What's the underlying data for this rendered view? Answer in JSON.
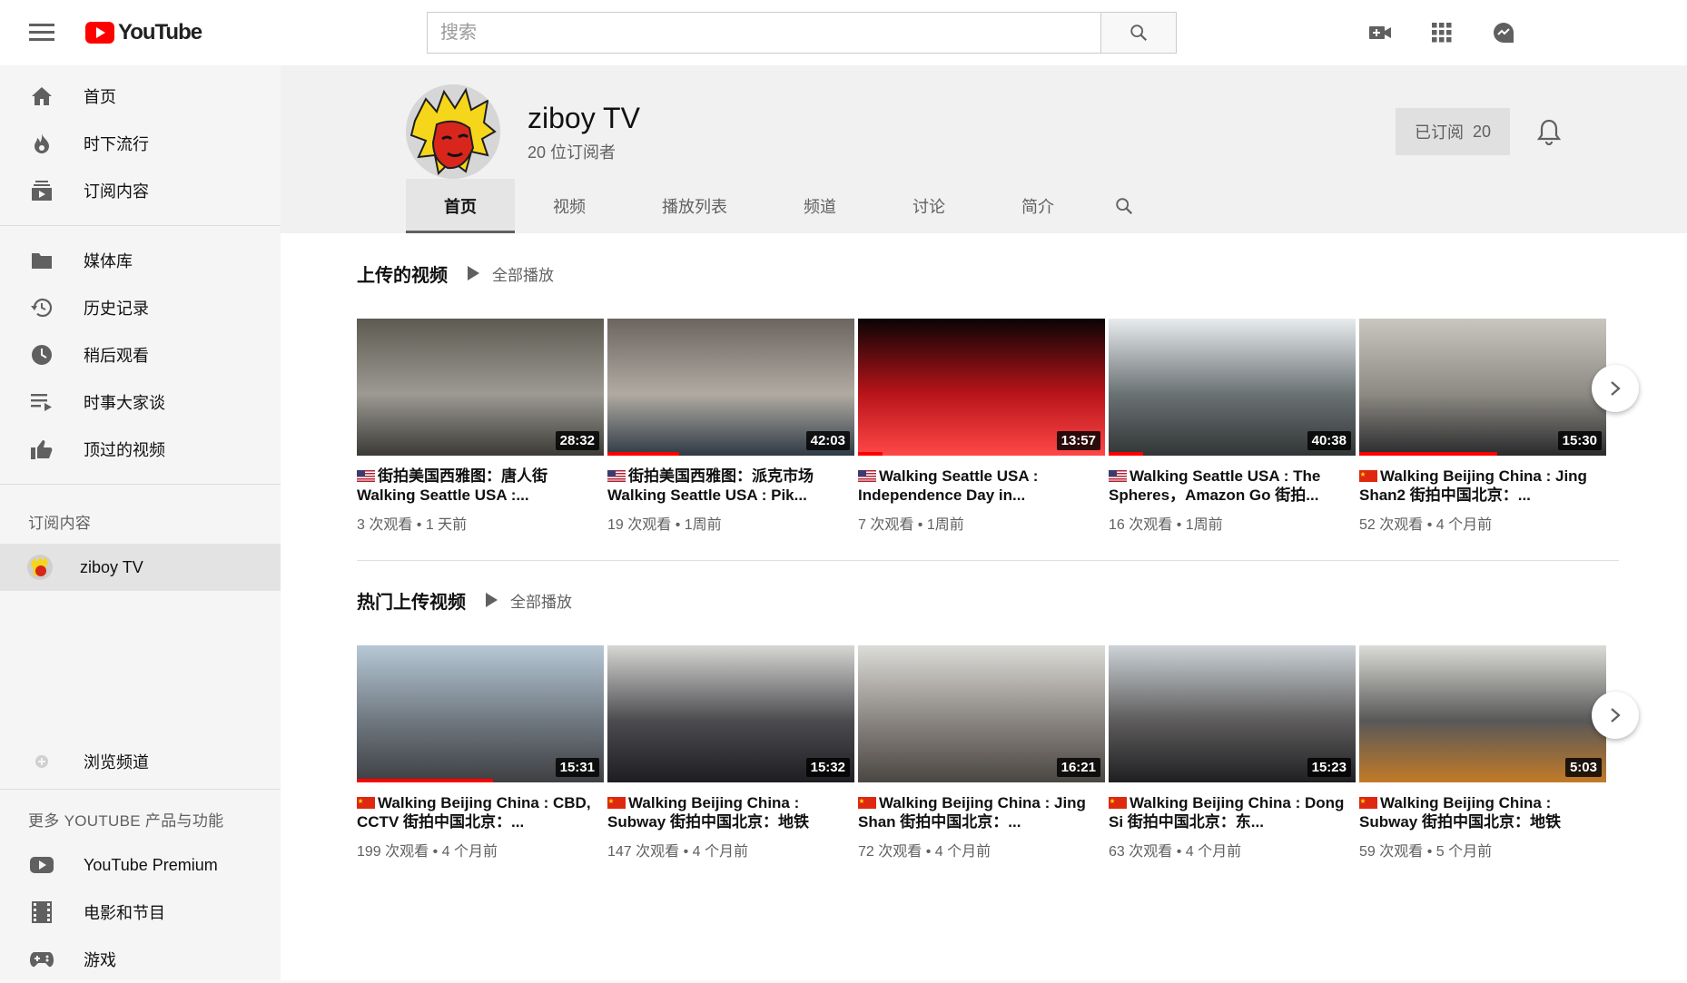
{
  "header": {
    "logo_text": "YouTube",
    "search_placeholder": "搜索"
  },
  "sidebar": {
    "main": [
      {
        "label": "首页",
        "icon": "home-icon"
      },
      {
        "label": "时下流行",
        "icon": "fire-icon"
      },
      {
        "label": "订阅内容",
        "icon": "subscriptions-icon"
      }
    ],
    "library": [
      {
        "label": "媒体库",
        "icon": "folder-icon"
      },
      {
        "label": "历史记录",
        "icon": "history-icon"
      },
      {
        "label": "稍后观看",
        "icon": "clock-icon"
      },
      {
        "label": "时事大家谈",
        "icon": "playlist-icon"
      },
      {
        "label": "顶过的视频",
        "icon": "thumbs-up-icon"
      }
    ],
    "subs_heading": "订阅内容",
    "subs": [
      {
        "label": "ziboy TV"
      }
    ],
    "browse": {
      "label": "浏览频道"
    },
    "more_heading": "更多 YOUTUBE 产品与功能",
    "more": [
      {
        "label": "YouTube Premium",
        "icon": "youtube-icon"
      },
      {
        "label": "电影和节目",
        "icon": "film-icon"
      },
      {
        "label": "游戏",
        "icon": "gamepad-icon"
      }
    ]
  },
  "channel": {
    "name": "ziboy TV",
    "subscribers": "20 位订阅者",
    "subscribe_label": "已订阅",
    "subscribe_count": "20",
    "tabs": [
      "首页",
      "视频",
      "播放列表",
      "频道",
      "讨论",
      "简介"
    ]
  },
  "shelves": [
    {
      "title": "上传的视频",
      "play_all": "全部播放",
      "videos": [
        {
          "flag": "us",
          "title": "街拍美国西雅图：唐人街 Walking Seattle USA :...",
          "duration": "28:32",
          "meta": "3 次观看 • 1 天前",
          "progress": 0,
          "colors": [
            "#5d5a52",
            "#9c9a92",
            "#3b3a36"
          ]
        },
        {
          "flag": "us",
          "title": "街拍美国西雅图：派克市场 Walking Seattle USA : Pik...",
          "duration": "42:03",
          "meta": "19 次观看 • 1周前",
          "progress": 0.29,
          "colors": [
            "#6d6460",
            "#b0aba2",
            "#2f3a45"
          ]
        },
        {
          "flag": "us",
          "title": "Walking Seattle USA : Independence Day in...",
          "duration": "13:57",
          "meta": "7 次观看 • 1周前",
          "progress": 0.1,
          "colors": [
            "#0a0405",
            "#b8141a",
            "#ff4848"
          ]
        },
        {
          "flag": "us",
          "title": "Walking Seattle USA : The Spheres，Amazon Go 街拍...",
          "duration": "40:38",
          "meta": "16 次观看 • 1周前",
          "progress": 0.14,
          "colors": [
            "#e8ecef",
            "#6b7274",
            "#313536"
          ]
        },
        {
          "flag": "cn",
          "title": "Walking Beijing China : Jing Shan2 街拍中国北京：...",
          "duration": "15:30",
          "meta": "52 次观看 • 4 个月前",
          "progress": 0.56,
          "colors": [
            "#c9c6bf",
            "#8d8a83",
            "#2a2a2c"
          ]
        }
      ]
    },
    {
      "title": "热门上传视频",
      "play_all": "全部播放",
      "videos": [
        {
          "flag": "cn",
          "title": "Walking Beijing China : CBD, CCTV 街拍中国北京：...",
          "duration": "15:31",
          "meta": "199 次观看 • 4 个月前",
          "progress": 0.55,
          "colors": [
            "#b7c8d6",
            "#6f7880",
            "#3e3f42"
          ]
        },
        {
          "flag": "cn",
          "title": "Walking Beijing China : Subway 街拍中国北京：地铁",
          "duration": "15:32",
          "meta": "147 次观看 • 4 个月前",
          "progress": 0,
          "colors": [
            "#d7d8d4",
            "#4c4b4f",
            "#1d1d22"
          ]
        },
        {
          "flag": "cn",
          "title": "Walking Beijing China : Jing Shan 街拍中国北京：...",
          "duration": "16:21",
          "meta": "72 次观看 • 4 个月前",
          "progress": 0,
          "colors": [
            "#dcdcd8",
            "#8a8580",
            "#4a4642"
          ]
        },
        {
          "flag": "cn",
          "title": "Walking Beijing China : Dong Si 街拍中国北京：东...",
          "duration": "15:23",
          "meta": "63 次观看 • 4 个月前",
          "progress": 0,
          "colors": [
            "#cdd3d8",
            "#5e5c5c",
            "#1f1f22"
          ]
        },
        {
          "flag": "cn",
          "title": "Walking Beijing China : Subway 街拍中国北京：地铁",
          "duration": "5:03",
          "meta": "59 次观看 • 5 个月前",
          "progress": 0,
          "colors": [
            "#dcdcd7",
            "#585858",
            "#c27a28"
          ]
        }
      ]
    }
  ]
}
